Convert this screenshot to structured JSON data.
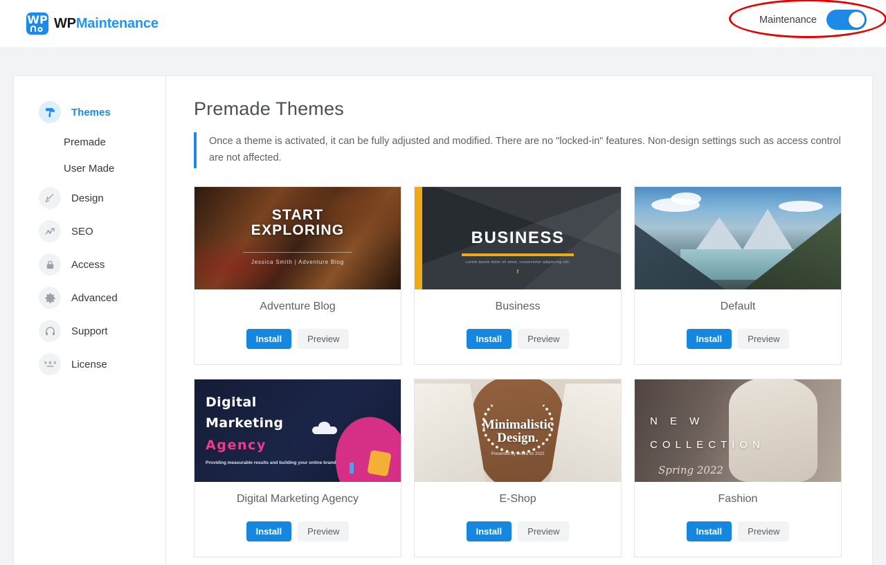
{
  "topbar": {
    "logo_mark_icon": "wp-maintenance-logo-icon",
    "logo_text_primary": "WP",
    "logo_text_secondary": "Maintenance",
    "maintenance_label": "Maintenance",
    "maintenance_toggle_state": "on",
    "annotation": "red-ellipse-highlight"
  },
  "sidebar": {
    "items": [
      {
        "label": "Themes",
        "icon": "paint-roller-icon",
        "active": true
      },
      {
        "label": "Premade",
        "icon": "",
        "sub": true
      },
      {
        "label": "User Made",
        "icon": "",
        "sub": true
      },
      {
        "label": "Design",
        "icon": "paint-brush-icon"
      },
      {
        "label": "SEO",
        "icon": "analytics-chart-icon"
      },
      {
        "label": "Access",
        "icon": "lock-icon"
      },
      {
        "label": "Advanced",
        "icon": "gear-icon"
      },
      {
        "label": "Support",
        "icon": "headset-icon"
      },
      {
        "label": "License",
        "icon": "password-key-icon"
      }
    ]
  },
  "main": {
    "title": "Premade Themes",
    "notice": "Once a theme is activated, it can be fully adjusted and modified. There are no \"locked-in\" features. Non-design settings such as access control are not affected.",
    "install_label": "Install",
    "preview_label": "Preview",
    "themes": [
      {
        "name": "Adventure Blog",
        "thumb_title": "START\nEXPLORING",
        "thumb_title_line1": "START",
        "thumb_title_line2": "EXPLORING",
        "thumb_subtitle": "Jessica Smith | Adventure Blog"
      },
      {
        "name": "Business",
        "thumb_title": "BUSINESS",
        "thumb_subtitle": "Lorem ipsum dolor sit amet, consectetur adipiscing elit.",
        "thumb_social": "f"
      },
      {
        "name": "Default",
        "thumb_title": "",
        "thumb_subtitle": ""
      },
      {
        "name": "Digital Marketing Agency",
        "thumb_title_line1": "Digital",
        "thumb_title_line2": "Marketing",
        "thumb_title_line3": "Agency",
        "thumb_subtitle": "Providing measurable results and building your online brand"
      },
      {
        "name": "E-Shop",
        "thumb_title_line1": "Minimalistic",
        "thumb_title_line2": "Design.",
        "thumb_subtitle": "Presented by Ioralla\nfor 2022"
      },
      {
        "name": "Fashion",
        "thumb_title_line1": "N E W",
        "thumb_title_line2": "COLLECTION",
        "thumb_subtitle": "Spring 2022"
      }
    ]
  },
  "colors": {
    "accent_blue": "#1e8ae8",
    "install_blue": "#1587df",
    "annotation_red": "#e60000",
    "page_background": "#f2f3f4",
    "panel_background": "#ffffff",
    "business_gold": "#eeab16",
    "agency_pink": "#ef3a8e"
  }
}
